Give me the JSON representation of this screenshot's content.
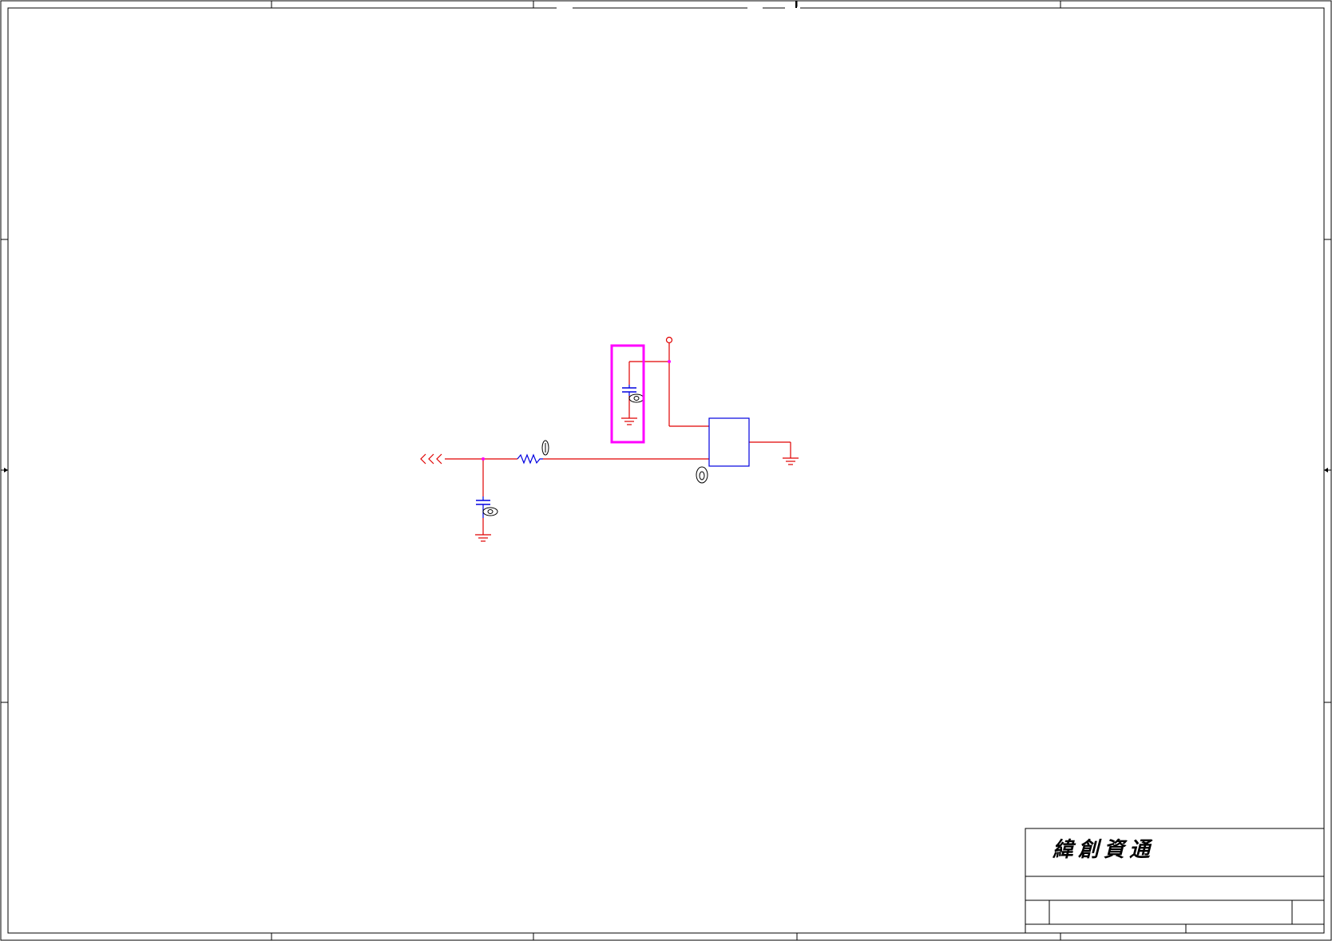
{
  "title_block": {
    "company": "緯創資通"
  },
  "colors": {
    "wire": "#e00000",
    "component": "#0000e0",
    "highlight": "#ff00ff",
    "frame": "#000000"
  },
  "components": {
    "chip": {
      "kind": "ic"
    },
    "resistor": {
      "kind": "resistor"
    },
    "capacitor_top": {
      "kind": "capacitor"
    },
    "capacitor_bottom": {
      "kind": "capacitor"
    },
    "connector": {
      "kind": "offpage-connector"
    },
    "power_pin": {
      "kind": "power-port"
    }
  }
}
